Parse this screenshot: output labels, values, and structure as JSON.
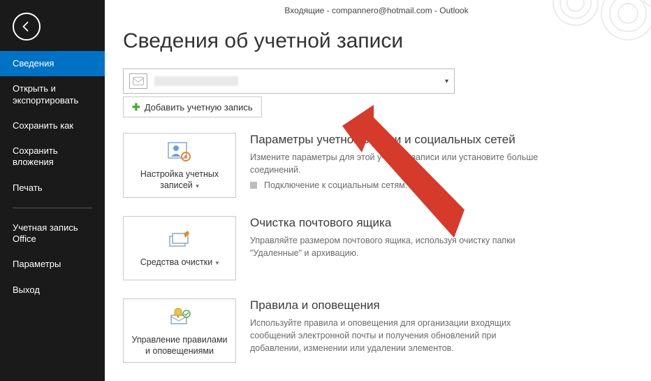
{
  "window_title": "Входящие - compannero@hotmail.com - Outlook",
  "page_title": "Сведения об учетной записи",
  "sidebar": {
    "items_top": [
      "Сведения",
      "Открыть и экспортировать",
      "Сохранить как",
      "Сохранить вложения",
      "Печать"
    ],
    "items_bottom": [
      "Учетная запись Office",
      "Параметры",
      "Выход"
    ]
  },
  "add_account_label": "Добавить учетную запись",
  "sections": {
    "s1": {
      "title": "Параметры учетной записи и социальных сетей",
      "desc": "Измените параметры для этой учетной записи или установите больше соединений.",
      "bullet": "Подключение к социальным сетям.",
      "button": "Настройка учетных записей"
    },
    "s2": {
      "title": "Очистка почтового ящика",
      "desc": "Управляйте размером почтового ящика, используя очистку папки \"Удаленные\" и архивацию.",
      "button": "Средства очистки"
    },
    "s3": {
      "title": "Правила и оповещения",
      "desc": "Используйте правила и оповещения для организации входящих сообщений электронной почты и получения обновлений при добавлении, изменении или удалении элементов.",
      "button": "Управление правилами и оповещениями"
    }
  }
}
